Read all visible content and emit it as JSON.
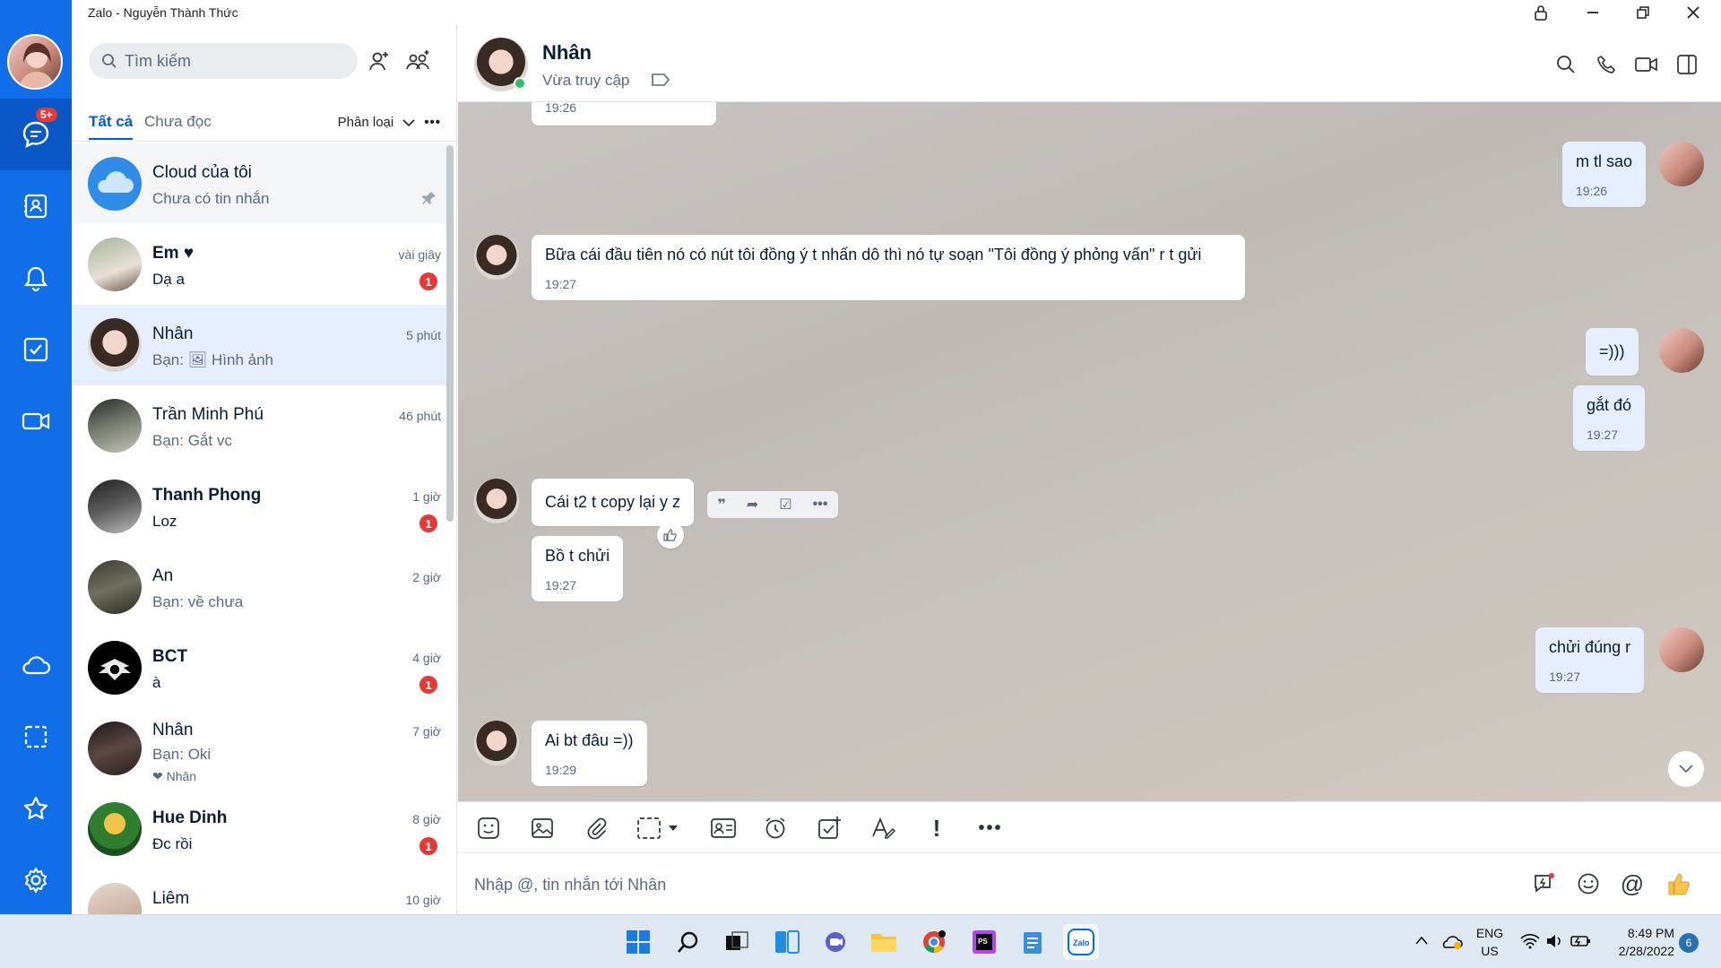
{
  "window": {
    "title": "Zalo - Nguyễn Thành Thức"
  },
  "rail": {
    "badge": "5+"
  },
  "list": {
    "search_placeholder": "Tìm kiếm",
    "tabs": [
      "Tất cả",
      "Chưa đọc"
    ],
    "filter_label": "Phân loại",
    "conversations": [
      {
        "name": "Cloud của tôi",
        "preview": "Chưa có tin nhắn",
        "time": "",
        "unread": "",
        "pinned": true
      },
      {
        "name": "Em ♥",
        "preview": "Dạ a",
        "time": "vài giây",
        "unread": "1"
      },
      {
        "name": "Nhân",
        "preview": "Bạn: 🖼 Hình ảnh",
        "time": "5 phút",
        "unread": "",
        "selected": true
      },
      {
        "name": "Trần Minh Phú",
        "preview": "Bạn: Gắt vc",
        "time": "46 phút",
        "unread": ""
      },
      {
        "name": "Thanh Phong",
        "preview": "Loz",
        "time": "1 giờ",
        "unread": "1"
      },
      {
        "name": "An",
        "preview": "Bạn: về chưa",
        "time": "2 giờ",
        "unread": ""
      },
      {
        "name": "BCT",
        "preview": "à",
        "time": "4 giờ",
        "unread": "1"
      },
      {
        "name": "Nhân",
        "preview": "Bạn: Oki",
        "sub": "❤ Nhân",
        "time": "7 giờ",
        "unread": ""
      },
      {
        "name": "Hue Dinh",
        "preview": "Đc rồi",
        "time": "8 giờ",
        "unread": "1"
      },
      {
        "name": "Liêm",
        "preview": "",
        "time": "10 giờ",
        "unread": ""
      }
    ]
  },
  "chat": {
    "name": "Nhân",
    "status": "Vừa truy cập",
    "messages": [
      {
        "from": "them",
        "text": "",
        "time": "19:26"
      },
      {
        "from": "me",
        "text": "m tl sao",
        "time": "19:26"
      },
      {
        "from": "them",
        "text": "Bữa cái đầu tiên nó có nút tôi đồng ý t nhấn dô thì nó tự soạn \"Tôi đồng ý phỏng vấn\" r t gửi",
        "time": "19:27"
      },
      {
        "from": "me",
        "text": "=)))",
        "time": ""
      },
      {
        "from": "me",
        "text": "gắt đó",
        "time": "19:27"
      },
      {
        "from": "them",
        "text": "Cái t2 t copy lại y z",
        "time": ""
      },
      {
        "from": "them",
        "text": "Bồ t chửi",
        "time": "19:27"
      },
      {
        "from": "me",
        "text": "chửi đúng r",
        "time": "19:27"
      },
      {
        "from": "them",
        "text": "Ai bt đâu =))",
        "time": "19:29"
      }
    ],
    "composer_placeholder": "Nhập @, tin nhắn tới Nhân"
  },
  "taskbar": {
    "lang_top": "ENG",
    "lang_bottom": "US",
    "time": "8:49 PM",
    "date": "2/28/2022",
    "notifications": "6"
  },
  "colors": {
    "accent": "#005ae0",
    "rail": "#0f6ee8",
    "unread_badge": "#e53935"
  }
}
